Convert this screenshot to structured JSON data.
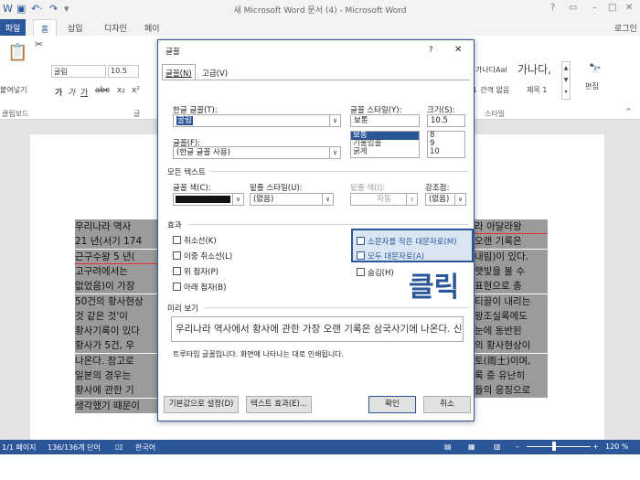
{
  "window": {
    "title": "새 Microsoft Word 문서 (4) - Microsoft Word",
    "login": "로그인",
    "help": "?"
  },
  "tabs": {
    "file": "파일",
    "home": "홈",
    "insert": "삽입",
    "design": "디자인",
    "layout": "페이"
  },
  "ribbon": {
    "paste": "붙여넣기",
    "clipboard": "클립보드",
    "font_group": "글",
    "font_name": "굴림",
    "font_size": "10.5",
    "style1_preview": "가나다Aal",
    "style2_preview": "가나다,",
    "style1": "↓ 간격 없음",
    "style2": "제목 1",
    "styles": "스타일",
    "editing": "편집"
  },
  "dialog": {
    "title": "글꼴",
    "help": "?",
    "close": "✕",
    "tab_font": "글꼴(N)",
    "tab_advanced": "고급(V)",
    "korean_font_label": "한글 글꼴(T):",
    "korean_font_value": "굴림",
    "font_style_label": "글꼴 스타일(Y):",
    "font_style_value": "보통",
    "size_label": "크기(S):",
    "size_value": "10.5",
    "font_label": "글꼴(F):",
    "font_value": "(한글 글꼴 사용)",
    "style_list": [
      "보통",
      "기울임꼴",
      "굵게"
    ],
    "size_list": [
      "8",
      "9",
      "10"
    ],
    "all_text": "모든 텍스트",
    "font_color_label": "글꼴 색(C):",
    "underline_style_label": "밑줄 스타일(U):",
    "underline_style_value": "(없음)",
    "underline_color_label": "밑줄 색(I):",
    "underline_color_value": "자동",
    "emphasis_label": "강조점:",
    "emphasis_value": "(없음)",
    "effects": "효과",
    "strikethrough": "취소선(K)",
    "double_strikethrough": "이중 취소선(L)",
    "superscript": "위 첨자(P)",
    "subscript": "아래 첨자(B)",
    "small_caps": "소문자를 작은 대문자로(M)",
    "all_caps": "모두 대문자로(A)",
    "hidden": "숨김(H)",
    "preview_label": "미리 보기",
    "preview_text": "우리나라 역사에서 황사에 관한 가장 오랜 기록은 삼국사기에 나온다. 신",
    "preview_note": "트루타입 글꼴입니다. 화면에 나타나는 대로 인쇄됩니다.",
    "set_default": "기본값으로 설정(D)",
    "text_effects": "텍스트 효과(E)...",
    "ok": "확인",
    "cancel": "취소",
    "click_annotation": "클릭",
    "accent_color": "#2b579a",
    "annotation_color": "#2b579a"
  },
  "document": {
    "lines_left": [
      "우리나라 역사",
      "21 년(서기 174",
      "근구수왕 5 년(",
      "고구려에서는 ",
      "없었음)이 가장",
      "50건의 황사현상",
      "것 같은 것'이",
      "황사기록이 있다",
      "황사가 5건, 우",
      "나온다. 참고로",
      "일본의 경우는",
      "황사에 관한 기",
      "생각했기 때문이"
    ],
    "lines_right": [
      "라 아달라왕",
      "오랜 기록은",
      "내림)이 있다.",
      "햇빛을 볼 수",
      "표현으로 총",
      "티끌이 내리는",
      "왕조실록에도",
      "눈에 동반된",
      "의 황사현상이",
      "토(雨土)이며,",
      "록 중 유난히",
      "들의 응징으로"
    ]
  },
  "status": {
    "page": "1/1 페이지",
    "words": "136/136개 단어",
    "language": "한국어",
    "zoom": "120 %"
  }
}
